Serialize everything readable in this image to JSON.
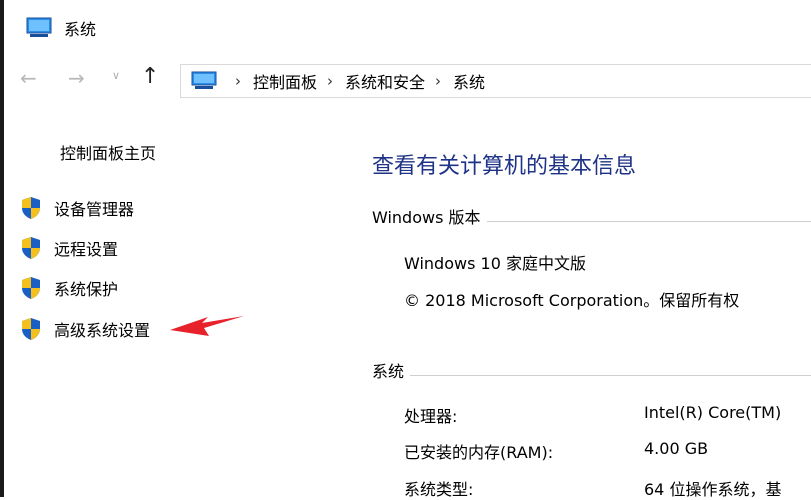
{
  "window": {
    "title": "系统"
  },
  "nav": {
    "back_icon": "back-arrow-icon",
    "forward_icon": "forward-arrow-icon",
    "recent_icon": "chevron-down-icon",
    "up_icon": "up-arrow-icon",
    "breadcrumbs": [
      "控制面板",
      "系统和安全",
      "系统"
    ]
  },
  "sidebar": {
    "home_link": "控制面板主页",
    "tasks": [
      {
        "label": "设备管理器",
        "icon": "uac-shield-icon"
      },
      {
        "label": "远程设置",
        "icon": "uac-shield-icon"
      },
      {
        "label": "系统保护",
        "icon": "uac-shield-icon"
      },
      {
        "label": "高级系统设置",
        "icon": "uac-shield-icon"
      }
    ]
  },
  "main": {
    "heading": "查看有关计算机的基本信息",
    "windows_edition": {
      "section_label": "Windows 版本",
      "edition": "Windows 10 家庭中文版",
      "copyright": "© 2018 Microsoft Corporation。保留所有权"
    },
    "system": {
      "section_label": "系统",
      "rows": [
        {
          "label": "处理器:",
          "value": "Intel(R) Core(TM)"
        },
        {
          "label": "已安装的内存(RAM):",
          "value": "4.00 GB"
        },
        {
          "label": "系统类型:",
          "value": "64 位操作系统，基"
        }
      ]
    }
  },
  "colors": {
    "heading": "#1e3287",
    "arrow": "#e8222a",
    "shield_blue": "#1a5fc4",
    "shield_yellow": "#f4c01e"
  }
}
